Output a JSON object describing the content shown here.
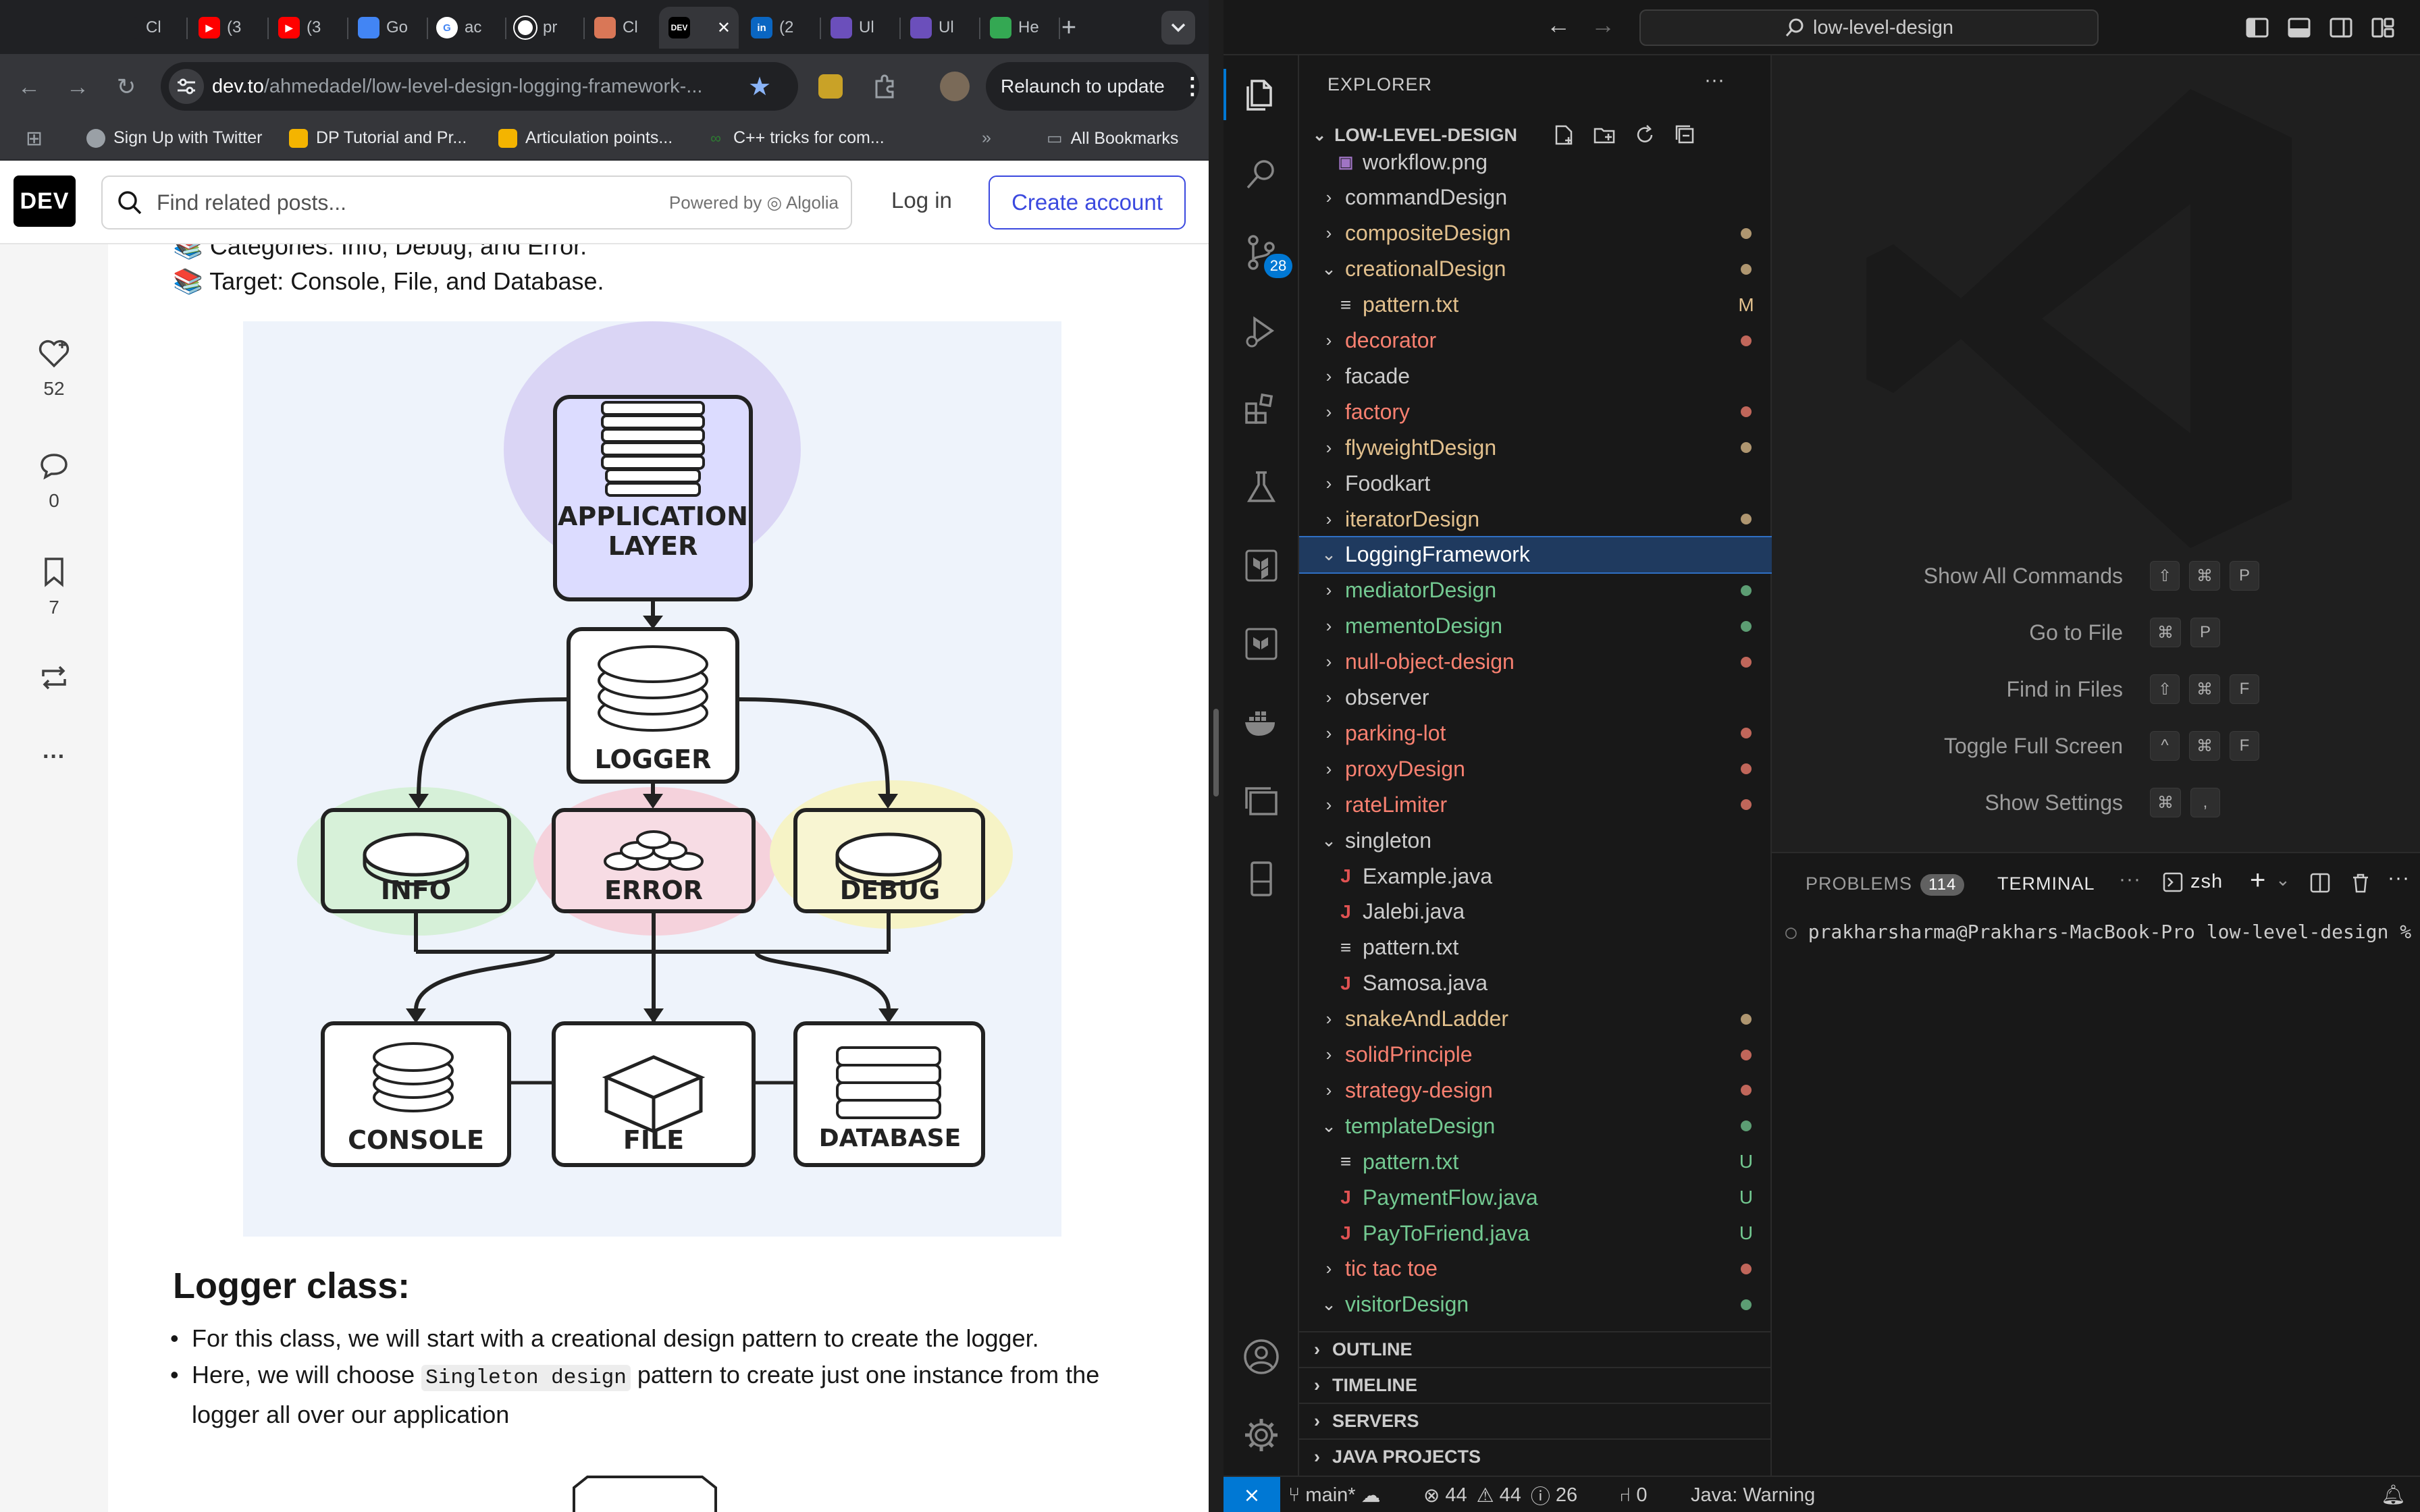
{
  "browser": {
    "tabs": [
      {
        "label": "Cl",
        "favicon": "openai-icon",
        "color": "#202124"
      },
      {
        "label": "(3",
        "favicon": "youtube-icon",
        "color": "#ff0000"
      },
      {
        "label": "(3",
        "favicon": "youtube-icon",
        "color": "#ff0000"
      },
      {
        "label": "Go",
        "favicon": "google-translate-icon",
        "color": "#4285f4"
      },
      {
        "label": "ac",
        "favicon": "google-icon",
        "color": "#ffffff"
      },
      {
        "label": "pr",
        "favicon": "github-icon",
        "color": "#ffffff"
      },
      {
        "label": "Cl",
        "favicon": "claude-icon",
        "color": "#d97757"
      },
      {
        "label": "",
        "favicon": "dev-icon",
        "color": "#000000",
        "active": true
      },
      {
        "label": "(2",
        "favicon": "linkedin-icon",
        "color": "#0a66c2"
      },
      {
        "label": "Ul",
        "favicon": "ui-icon",
        "color": "#6b4fbb"
      },
      {
        "label": "Ul",
        "favicon": "ui-icon",
        "color": "#6b4fbb"
      },
      {
        "label": "He",
        "favicon": "drive-icon",
        "color": "#34a853"
      }
    ],
    "url_host": "dev.to",
    "url_path": "/ahmedadel/low-level-design-logging-framework-...",
    "relaunch_label": "Relaunch to update",
    "bookmarks": [
      {
        "label": "Sign Up with Twitter",
        "color": "#9aa0a6"
      },
      {
        "label": "DP Tutorial and Pr...",
        "color": "#f4b400"
      },
      {
        "label": "Articulation points...",
        "color": "#f4b400"
      },
      {
        "label": "C++ tricks for com...",
        "color": "#2e7d32"
      }
    ],
    "all_bookmarks": "All Bookmarks"
  },
  "devto": {
    "logo": "DEV",
    "search_placeholder": "Find related posts...",
    "powered_by": "Powered by",
    "algolia": "Algolia",
    "login": "Log in",
    "create_account": "Create account",
    "reactions": [
      {
        "icon": "heart-icon",
        "count": "52"
      },
      {
        "icon": "comment-icon",
        "count": "0"
      },
      {
        "icon": "bookmark-icon",
        "count": "7"
      }
    ],
    "line_categories": "Categories: Info, Debug, and Error.",
    "line_target": "Target: Console, File, and Database.",
    "diagram": {
      "app_layer_1": "APPLICATION",
      "app_layer_2": "LAYER",
      "logger": "LOGGER",
      "info": "INFO",
      "error": "ERROR",
      "debug": "DEBUG",
      "console": "CONSOLE",
      "file": "FILE",
      "database": "DATABASE"
    },
    "logger_heading": "Logger class:",
    "bullet1": "For this class, we will start with a creational design pattern to create the logger.",
    "bullet2_pre": "Here, we will choose",
    "bullet2_code": "Singleton design",
    "bullet2_post": "pattern to create just one instance from the logger all over our application"
  },
  "vscode": {
    "search": "low-level-design",
    "explorer_title": "EXPLORER",
    "workspace": "LOW-LEVEL-DESIGN",
    "scm_badge": "28",
    "colors": {
      "modified": "#e2c08d",
      "error": "#f88070",
      "untracked": "#73c991",
      "plain": "#cccccc"
    },
    "tree": [
      {
        "label": "workflow.png",
        "kind": "image",
        "indent": 1,
        "status": "plain"
      },
      {
        "label": "commandDesign",
        "kind": "folder",
        "status": "plain"
      },
      {
        "label": "compositeDesign",
        "kind": "folder",
        "status": "modified",
        "dot": true
      },
      {
        "label": "creationalDesign",
        "kind": "folder-open",
        "status": "modified",
        "dot": true
      },
      {
        "label": "pattern.txt",
        "kind": "text",
        "indent": 1,
        "status": "modified",
        "deco": "M"
      },
      {
        "label": "decorator",
        "kind": "folder",
        "status": "error",
        "dot": true
      },
      {
        "label": "facade",
        "kind": "folder",
        "status": "plain"
      },
      {
        "label": "factory",
        "kind": "folder",
        "status": "error",
        "dot": true
      },
      {
        "label": "flyweightDesign",
        "kind": "folder",
        "status": "modified",
        "dot": true
      },
      {
        "label": "Foodkart",
        "kind": "folder",
        "status": "plain"
      },
      {
        "label": "iteratorDesign",
        "kind": "folder",
        "status": "modified",
        "dot": true
      },
      {
        "label": "LoggingFramework",
        "kind": "folder-open",
        "status": "plain",
        "selected": true
      },
      {
        "label": "mediatorDesign",
        "kind": "folder",
        "status": "untracked",
        "dot": true
      },
      {
        "label": "mementoDesign",
        "kind": "folder",
        "status": "untracked",
        "dot": true
      },
      {
        "label": "null-object-design",
        "kind": "folder",
        "status": "error",
        "dot": true
      },
      {
        "label": "observer",
        "kind": "folder",
        "status": "plain"
      },
      {
        "label": "parking-lot",
        "kind": "folder",
        "status": "error",
        "dot": true
      },
      {
        "label": "proxyDesign",
        "kind": "folder",
        "status": "error",
        "dot": true
      },
      {
        "label": "rateLimiter",
        "kind": "folder",
        "status": "error",
        "dot": true
      },
      {
        "label": "singleton",
        "kind": "folder-open",
        "status": "plain"
      },
      {
        "label": "Example.java",
        "kind": "java",
        "indent": 1,
        "status": "plain"
      },
      {
        "label": "Jalebi.java",
        "kind": "java",
        "indent": 1,
        "status": "plain"
      },
      {
        "label": "pattern.txt",
        "kind": "text",
        "indent": 1,
        "status": "plain"
      },
      {
        "label": "Samosa.java",
        "kind": "java",
        "indent": 1,
        "status": "plain"
      },
      {
        "label": "snakeAndLadder",
        "kind": "folder",
        "status": "modified",
        "dot": true
      },
      {
        "label": "solidPrinciple",
        "kind": "folder",
        "status": "error",
        "dot": true
      },
      {
        "label": "strategy-design",
        "kind": "folder",
        "status": "error",
        "dot": true
      },
      {
        "label": "templateDesign",
        "kind": "folder-open",
        "status": "untracked",
        "dot": true
      },
      {
        "label": "pattern.txt",
        "kind": "text",
        "indent": 1,
        "status": "untracked",
        "deco": "U"
      },
      {
        "label": "PaymentFlow.java",
        "kind": "java",
        "indent": 1,
        "status": "untracked",
        "deco": "U"
      },
      {
        "label": "PayToFriend.java",
        "kind": "java",
        "indent": 1,
        "status": "untracked",
        "deco": "U"
      },
      {
        "label": "tic tac toe",
        "kind": "folder",
        "status": "error",
        "dot": true
      },
      {
        "label": "visitorDesign",
        "kind": "folder-open",
        "status": "untracked",
        "dot": true
      }
    ],
    "sections": [
      "OUTLINE",
      "TIMELINE",
      "SERVERS",
      "JAVA PROJECTS"
    ],
    "shortcuts": [
      {
        "label": "Show All Commands",
        "keys": [
          "⇧",
          "⌘",
          "P"
        ]
      },
      {
        "label": "Go to File",
        "keys": [
          "⌘",
          "P"
        ]
      },
      {
        "label": "Find in Files",
        "keys": [
          "⇧",
          "⌘",
          "F"
        ]
      },
      {
        "label": "Toggle Full Screen",
        "keys": [
          "^",
          "⌘",
          "F"
        ]
      },
      {
        "label": "Show Settings",
        "keys": [
          "⌘",
          ","
        ]
      }
    ],
    "panel": {
      "problems": "PROBLEMS",
      "problems_count": "114",
      "terminal": "TERMINAL",
      "shell": "zsh",
      "prompt": "prakharsharma@Prakhars-MacBook-Pro low-level-design %"
    },
    "status": {
      "branch": "main*",
      "errors": "44",
      "warnings": "44",
      "infos": "26",
      "ports": "0",
      "java": "Java: Warning"
    }
  }
}
